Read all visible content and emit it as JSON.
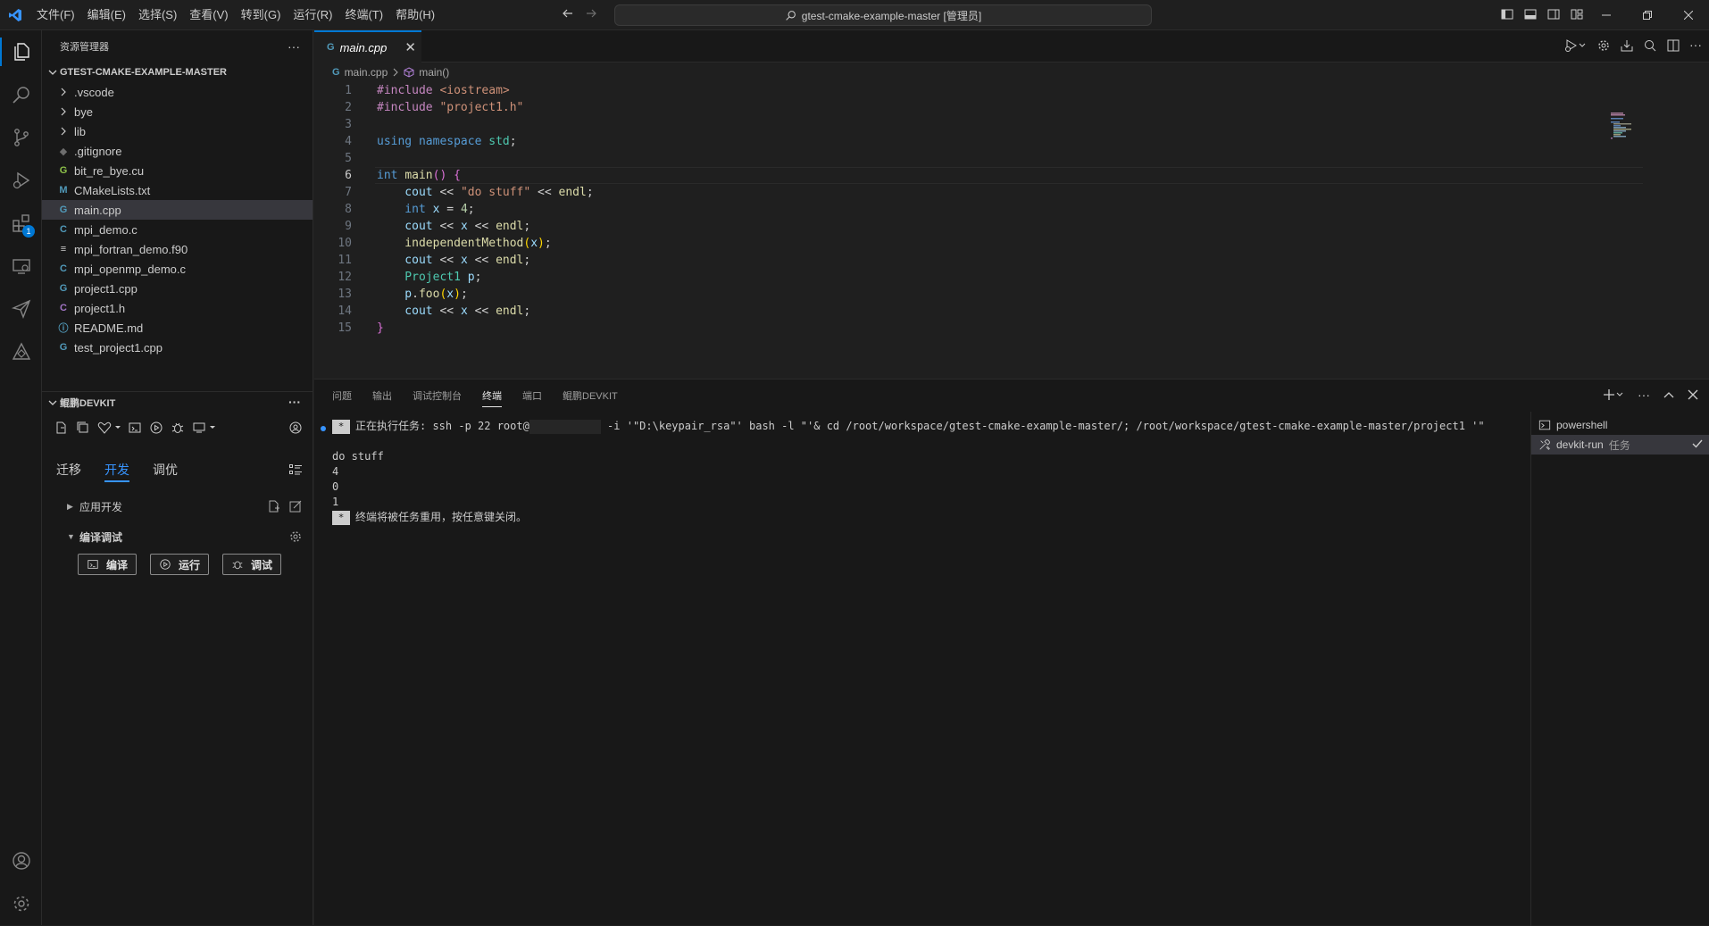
{
  "titlebar": {
    "menu": [
      "文件(F)",
      "编辑(E)",
      "选择(S)",
      "查看(V)",
      "转到(G)",
      "运行(R)",
      "终端(T)",
      "帮助(H)"
    ],
    "command_center": "gtest-cmake-example-master [管理员]"
  },
  "sidebar": {
    "title": "资源管理器",
    "more": "···",
    "folder": "GTEST-CMAKE-EXAMPLE-MASTER",
    "items": [
      {
        "label": ".vscode",
        "kind": "folder"
      },
      {
        "label": "bye",
        "kind": "folder"
      },
      {
        "label": "lib",
        "kind": "folder"
      },
      {
        "label": ".gitignore",
        "kind": "file",
        "icon": "◆",
        "color": "#6d6d6d"
      },
      {
        "label": "bit_re_bye.cu",
        "kind": "file",
        "icon": "G",
        "color": "#8dc149"
      },
      {
        "label": "CMakeLists.txt",
        "kind": "file",
        "icon": "M",
        "color": "#519aba"
      },
      {
        "label": "main.cpp",
        "kind": "file",
        "icon": "G",
        "color": "#519aba"
      },
      {
        "label": "mpi_demo.c",
        "kind": "file",
        "icon": "C",
        "color": "#519aba"
      },
      {
        "label": "mpi_fortran_demo.f90",
        "kind": "file",
        "icon": "≡",
        "color": "#cccccc"
      },
      {
        "label": "mpi_openmp_demo.c",
        "kind": "file",
        "icon": "C",
        "color": "#519aba"
      },
      {
        "label": "project1.cpp",
        "kind": "file",
        "icon": "G",
        "color": "#519aba"
      },
      {
        "label": "project1.h",
        "kind": "file",
        "icon": "C",
        "color": "#a074c4"
      },
      {
        "label": "README.md",
        "kind": "file",
        "icon": "ⓘ",
        "color": "#519aba"
      },
      {
        "label": "test_project1.cpp",
        "kind": "file",
        "icon": "G",
        "color": "#519aba"
      }
    ]
  },
  "devkit": {
    "title": "鲲鹏DEVKIT",
    "more": "···",
    "tabs": [
      "迁移",
      "开发",
      "调优"
    ],
    "active_tab": "开发",
    "groups": [
      "应用开发",
      "编译调试"
    ],
    "buttons": [
      "编译",
      "运行",
      "调试"
    ]
  },
  "editor": {
    "tab_label": "main.cpp",
    "breadcrumb": [
      "main.cpp",
      "main()"
    ],
    "current_line": 6,
    "lines": [
      [
        {
          "t": "#include ",
          "c": "pp"
        },
        {
          "t": "<iostream>",
          "c": "st"
        }
      ],
      [
        {
          "t": "#include ",
          "c": "pp"
        },
        {
          "t": "\"project1.h\"",
          "c": "st"
        }
      ],
      [],
      [
        {
          "t": "using ",
          "c": "kw"
        },
        {
          "t": "namespace ",
          "c": "kw"
        },
        {
          "t": "std",
          "c": "cls"
        },
        {
          "t": ";",
          "c": ""
        }
      ],
      [],
      [
        {
          "t": "int ",
          "c": "kw"
        },
        {
          "t": "main",
          "c": "fn"
        },
        {
          "t": "()",
          "c": "br2"
        },
        {
          "t": " ",
          "c": ""
        },
        {
          "t": "{",
          "c": "br2"
        }
      ],
      [
        {
          "t": "    cout",
          "c": "vr"
        },
        {
          "t": " << ",
          "c": ""
        },
        {
          "t": "\"do stuff\"",
          "c": "st"
        },
        {
          "t": " << ",
          "c": ""
        },
        {
          "t": "endl",
          "c": "fn"
        },
        {
          "t": ";",
          "c": ""
        }
      ],
      [
        {
          "t": "    int ",
          "c": "kw"
        },
        {
          "t": "x",
          "c": "vr"
        },
        {
          "t": " = ",
          "c": ""
        },
        {
          "t": "4",
          "c": "nm"
        },
        {
          "t": ";",
          "c": ""
        }
      ],
      [
        {
          "t": "    cout",
          "c": "vr"
        },
        {
          "t": " << ",
          "c": ""
        },
        {
          "t": "x",
          "c": "vr"
        },
        {
          "t": " << ",
          "c": ""
        },
        {
          "t": "endl",
          "c": "fn"
        },
        {
          "t": ";",
          "c": ""
        }
      ],
      [
        {
          "t": "    independentMethod",
          "c": "fn"
        },
        {
          "t": "(",
          "c": "br"
        },
        {
          "t": "x",
          "c": "vr"
        },
        {
          "t": ")",
          "c": "br"
        },
        {
          "t": ";",
          "c": ""
        }
      ],
      [
        {
          "t": "    cout",
          "c": "vr"
        },
        {
          "t": " << ",
          "c": ""
        },
        {
          "t": "x",
          "c": "vr"
        },
        {
          "t": " << ",
          "c": ""
        },
        {
          "t": "endl",
          "c": "fn"
        },
        {
          "t": ";",
          "c": ""
        }
      ],
      [
        {
          "t": "    Project1",
          "c": "cls"
        },
        {
          "t": " ",
          "c": ""
        },
        {
          "t": "p",
          "c": "vr"
        },
        {
          "t": ";",
          "c": ""
        }
      ],
      [
        {
          "t": "    p",
          "c": "vr"
        },
        {
          "t": ".",
          "c": ""
        },
        {
          "t": "foo",
          "c": "fn"
        },
        {
          "t": "(",
          "c": "br"
        },
        {
          "t": "x",
          "c": "vr"
        },
        {
          "t": ")",
          "c": "br"
        },
        {
          "t": ";",
          "c": ""
        }
      ],
      [
        {
          "t": "    cout",
          "c": "vr"
        },
        {
          "t": " << ",
          "c": ""
        },
        {
          "t": "x",
          "c": "vr"
        },
        {
          "t": " << ",
          "c": ""
        },
        {
          "t": "endl",
          "c": "fn"
        },
        {
          "t": ";",
          "c": ""
        }
      ],
      [
        {
          "t": "}",
          "c": "br2"
        }
      ]
    ]
  },
  "panel": {
    "tabs": [
      "问题",
      "输出",
      "调试控制台",
      "终端",
      "端口",
      "鲲鹏DEVKIT"
    ],
    "active_tab": "终端",
    "terminal": {
      "task_prefix": "正在执行任务: ssh -p 22 root@",
      "task_suffix": " -i '\"D:\\keypair_rsa\"' bash -l \"'& cd /root/workspace/gtest-cmake-example-master/; /root/workspace/gtest-cmake-example-master/project1 '\"",
      "output": [
        "do stuff",
        "4",
        "0",
        "1"
      ],
      "reuse_msg": "终端将被任务重用，按任意键关闭。",
      "star": "*"
    },
    "terminals": [
      {
        "label": "powershell",
        "sub": ""
      },
      {
        "label": "devkit-run",
        "sub": "任务"
      }
    ]
  }
}
